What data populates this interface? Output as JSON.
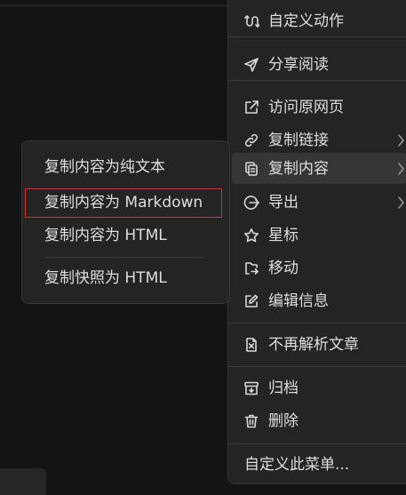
{
  "main_menu": {
    "items": [
      {
        "label": "自定义动作",
        "icon": "custom-action-icon",
        "has_submenu": false
      },
      {
        "label": "分享阅读",
        "icon": "send-icon",
        "has_submenu": false
      },
      {
        "label": "访问原网页",
        "icon": "external-link-icon",
        "has_submenu": false
      },
      {
        "label": "复制链接",
        "icon": "link-icon",
        "has_submenu": true
      },
      {
        "label": "复制内容",
        "icon": "copy-icon",
        "has_submenu": true,
        "active": true
      },
      {
        "label": "导出",
        "icon": "export-icon",
        "has_submenu": true
      },
      {
        "label": "星标",
        "icon": "star-icon",
        "has_submenu": false
      },
      {
        "label": "移动",
        "icon": "move-icon",
        "has_submenu": false
      },
      {
        "label": "编辑信息",
        "icon": "edit-icon",
        "has_submenu": false
      },
      {
        "label": "不再解析文章",
        "icon": "close-box-icon",
        "has_submenu": false
      },
      {
        "label": "归档",
        "icon": "archive-icon",
        "has_submenu": false
      },
      {
        "label": "删除",
        "icon": "trash-icon",
        "has_submenu": false
      },
      {
        "label": "自定义此菜单...",
        "icon": "",
        "has_submenu": false
      }
    ]
  },
  "sub_menu": {
    "items": [
      {
        "label": "复制内容为纯文本"
      },
      {
        "label": "复制内容为 Markdown",
        "highlighted": true
      },
      {
        "label": "复制内容为 HTML"
      },
      {
        "label": "复制快照为 HTML"
      }
    ]
  },
  "colors": {
    "background": "#141414",
    "menu_bg": "#242424",
    "active_bg": "#363636",
    "highlight_border": "#d8302a",
    "text": "#dedede"
  }
}
